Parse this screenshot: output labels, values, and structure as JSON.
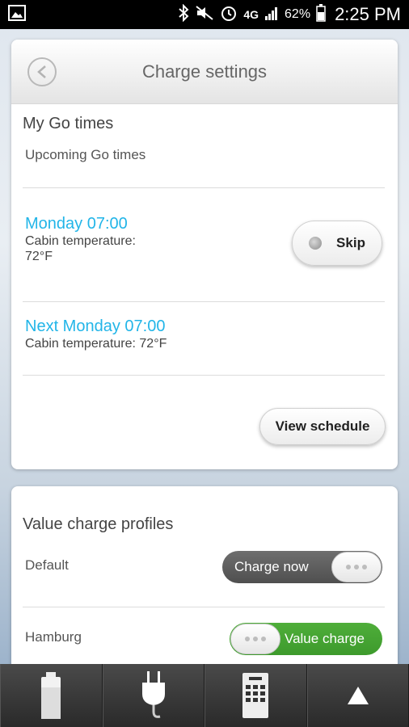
{
  "status_bar": {
    "battery": "62%",
    "time": "2:25 PM",
    "network": "4G"
  },
  "header": {
    "title": "Charge settings"
  },
  "go_times": {
    "section_title": "My Go times",
    "subtitle": "Upcoming Go times",
    "items": [
      {
        "day": "Monday 07:00",
        "temperature_line1": "Cabin temperature:",
        "temperature_line2": "72°F"
      },
      {
        "day": "Next Monday 07:00",
        "temperature": "Cabin temperature: 72°F"
      }
    ],
    "skip_label": "Skip",
    "view_schedule_label": "View schedule"
  },
  "value_charge": {
    "section_title": "Value charge profiles",
    "profiles": [
      {
        "name": "Default",
        "state": "Charge now"
      },
      {
        "name": "Hamburg",
        "state": "Value charge"
      }
    ]
  },
  "colors": {
    "accent_blue": "#22b5e8",
    "toggle_green": "#46a533",
    "toggle_gray": "#5f5f5f"
  },
  "icons": {
    "nav": [
      "battery-icon",
      "charger-plug-icon",
      "remote-control-icon",
      "up-arrow-icon"
    ]
  }
}
